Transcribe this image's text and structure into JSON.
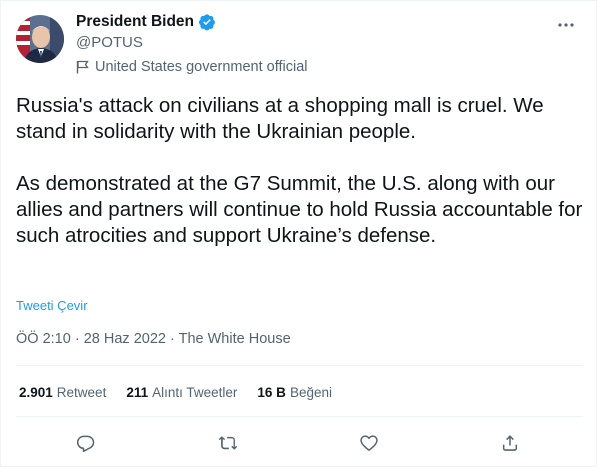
{
  "author": {
    "name": "President Biden",
    "handle": "@POTUS",
    "label": "United States government official"
  },
  "tweet": {
    "text": "Russia's attack on civilians at a shopping mall is cruel. We stand in solidarity with the Ukrainian people.\n\nAs demonstrated at the G7 Summit, the U.S. along with our allies and partners will continue to hold Russia accountable for such atrocities and support Ukraine’s defense.",
    "translate_label": "Tweeti Çevir",
    "time": "ÖÖ 2:10",
    "date": "28 Haz 2022",
    "separator": "·",
    "source": "The White House"
  },
  "stats": {
    "retweets": {
      "count": "2.901",
      "label": "Retweet"
    },
    "quotes": {
      "count": "211",
      "label": "Alıntı Tweetler"
    },
    "likes": {
      "count": "16 B",
      "label": "Beğeni"
    }
  },
  "icons": {
    "verified": "verified-badge-icon",
    "label_flag": "flag-icon",
    "more": "more-horizontal-icon",
    "reply": "reply-bubble-icon",
    "retweet": "retweet-icon",
    "like": "heart-icon",
    "share": "share-upload-icon"
  },
  "colors": {
    "accent": "#1d9bf0",
    "text_primary": "#0f1419",
    "text_secondary": "#536471",
    "divider": "#eff3f4"
  }
}
